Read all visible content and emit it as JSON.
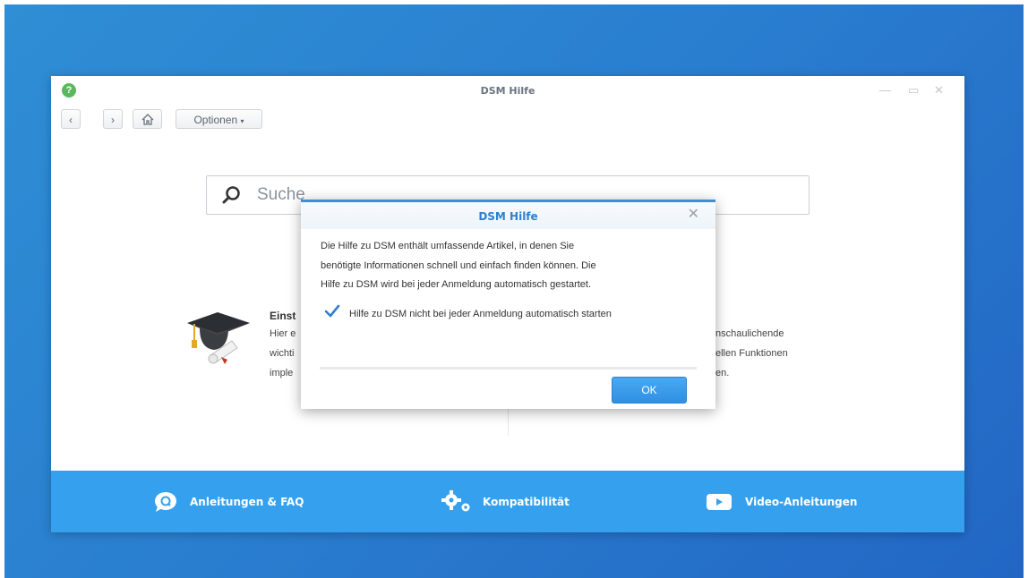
{
  "window": {
    "title": "DSM Hilfe"
  },
  "toolbar": {
    "options_label": "Optionen"
  },
  "search": {
    "placeholder": "Suche"
  },
  "card_left": {
    "title": "Einst",
    "lines": [
      "Hier e",
      "wichti",
      "imple"
    ]
  },
  "card_right": {
    "lines": [
      "nschaulichende",
      "ellen Funktionen",
      "en."
    ]
  },
  "footer": {
    "faq_label": "Anleitungen & FAQ",
    "compat_label": "Kompatibilität",
    "video_label": "Video-Anleitungen"
  },
  "dialog": {
    "title": "DSM Hilfe",
    "text_lines": [
      "Die Hilfe zu DSM enthält umfassende Artikel, in denen Sie",
      "benötigte Informationen schnell und einfach finden können. Die",
      "Hilfe zu DSM wird bei jeder Anmeldung automatisch gestartet."
    ],
    "checkbox_label": "Hilfe zu DSM nicht bei jeder Anmeldung automatisch starten",
    "checkbox_checked": true,
    "ok_label": "OK"
  },
  "colors": {
    "desktop": "#2a7fd0",
    "footer": "#35a1ee",
    "accent": "#2f7fd1"
  }
}
